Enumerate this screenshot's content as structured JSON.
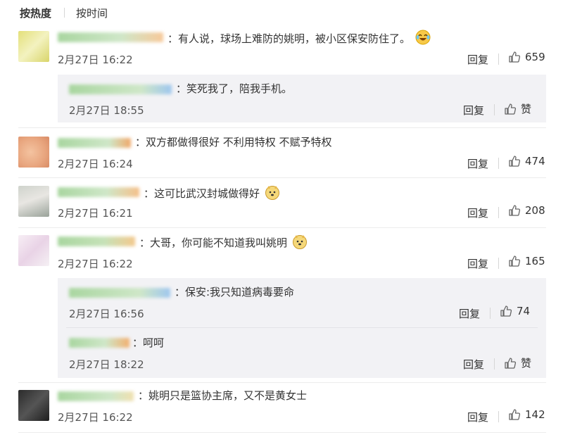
{
  "tabs": {
    "hot": "按热度",
    "time": "按时间"
  },
  "labels": {
    "reply": "回复",
    "like": "赞"
  },
  "comments": [
    {
      "text": "：有人说，球场上难防的姚明，被小区保安防住了。",
      "time": "2月27日 16:22",
      "likes": "659"
    },
    {
      "text": "：笑死我了，陪我手机。",
      "time": "2月27日 18:55",
      "likes": "赞"
    },
    {
      "text": "：双方都做得很好 不利用特权 不赋予特权",
      "time": "2月27日 16:24",
      "likes": "474"
    },
    {
      "text": "：这可比武汉封城做得好",
      "time": "2月27日 16:21",
      "likes": "208"
    },
    {
      "text": "：大哥，你可能不知道我叫姚明",
      "time": "2月27日 16:22",
      "likes": "165"
    },
    {
      "text": "：保安:我只知道病毒要命",
      "time": "2月27日 16:56",
      "likes": "74"
    },
    {
      "text": "：呵呵",
      "time": "2月27日 18:22",
      "likes": "赞"
    },
    {
      "text": "：姚明只是篮协主席，又不是黄女士",
      "time": "2月27日 16:22",
      "likes": "142"
    }
  ],
  "colors": {
    "accent": "#333333",
    "separator": "#ececec",
    "reply_bg": "#f2f2f5",
    "emoji_face": "#f7c948"
  }
}
